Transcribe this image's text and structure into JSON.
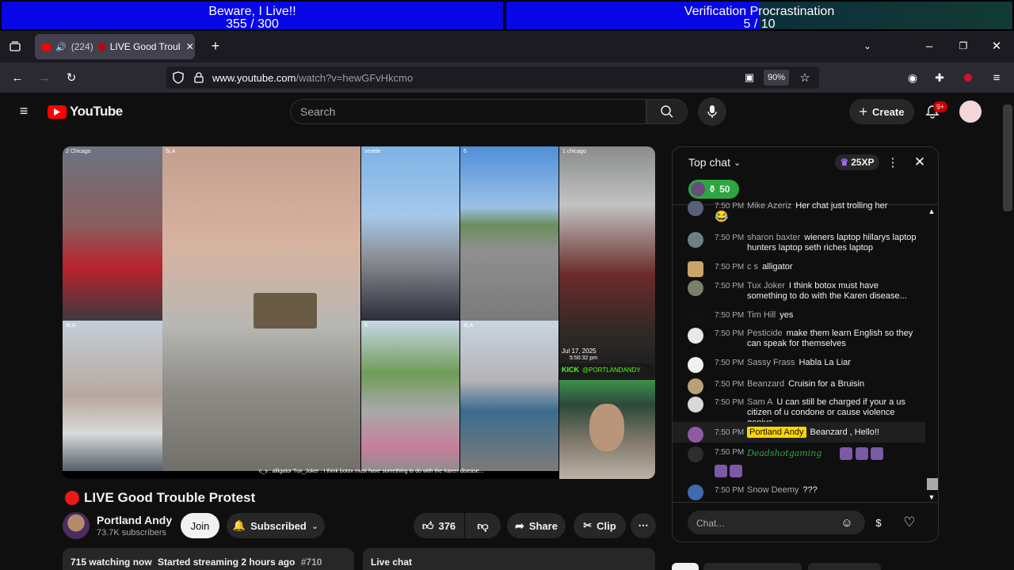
{
  "overlay": {
    "goal1_title": "Beware, I Live!!",
    "goal1_value": "355 / 300",
    "goal2_title": "Verification Procrastination",
    "goal2_value": "5 / 10",
    "goal2_progress": 0.5
  },
  "browser": {
    "tab_count_label": "(224)",
    "tab_title": "LIVE Good Troubl",
    "url_domain": "www.youtube.com",
    "url_path": "/watch?v=hewGFvHkcmo",
    "zoom": "90%"
  },
  "youtube": {
    "logo_text": "YouTube",
    "search_placeholder": "Search",
    "create_label": "Create",
    "notifications_badge": "9+"
  },
  "video": {
    "cells": [
      {
        "label": "2 Chicago"
      },
      {
        "label": "5LA"
      },
      {
        "label": "seattle"
      },
      {
        "label": "6"
      },
      {
        "label": "1 chicago"
      },
      {
        "label": "3LA"
      },
      {
        "label": "5"
      },
      {
        "label": "4LA"
      }
    ],
    "overlay_date": "Jul 17, 2025",
    "overlay_time": "5:50:32 pm",
    "overlay_handle": "@PORTLANDANDY",
    "overlay_kick": "KICK",
    "ticker": "c_s : alligator   Tux_Joker : I think botox must have something to do with the Karen disease..."
  },
  "stream": {
    "title": "LIVE Good Trouble Protest",
    "channel": "Portland Andy",
    "subscribers": "73.7K subscribers",
    "join_label": "Join",
    "subscribed_label": "Subscribed",
    "likes": "376",
    "share_label": "Share",
    "clip_label": "Clip",
    "watching": "715 watching now",
    "started": "Started streaming 2 hours ago",
    "hashtag": "#710",
    "live_chat_label": "Live chat"
  },
  "chat": {
    "header": "Top chat",
    "xp": "25XP",
    "points": "50",
    "input_placeholder": "Chat...",
    "messages": [
      {
        "time": "7:50 PM",
        "author": "Mike Azeriz",
        "text": "Her chat just trolling her",
        "emoji": "😂"
      },
      {
        "time": "7:50 PM",
        "author": "sharon baxter",
        "text": "wieners laptop hillarys laptop hunters laptop seth riches laptop"
      },
      {
        "time": "7:50 PM",
        "author": "c s",
        "text": "alligator"
      },
      {
        "time": "7:50 PM",
        "author": "Tux Joker",
        "text": "I think botox must have something to do with the Karen disease..."
      },
      {
        "time": "7:50 PM",
        "author": "Tim Hill",
        "text": "yes"
      },
      {
        "time": "7:50 PM",
        "author": "Pesticide",
        "text": "make them learn English so they can speak for themselves"
      },
      {
        "time": "7:50 PM",
        "author": "Sassy Frass",
        "text": "Habla La Liar"
      },
      {
        "time": "7:50 PM",
        "author": "Beanzard",
        "text": "Cruisin for a Bruisin"
      },
      {
        "time": "7:50 PM",
        "author": "Sam A",
        "text": "U can still be charged if your a us citizen of u condone or cause violence genius"
      },
      {
        "time": "7:50 PM",
        "author": "Portland Andy",
        "text": "Beanzard , Hello!!"
      },
      {
        "time": "7:50 PM",
        "author": "Deadshotgaming",
        "text": ""
      },
      {
        "time": "7:50 PM",
        "author": "Snow Deemy",
        "text": "???"
      }
    ]
  },
  "colors": {
    "goal_blue": "#0707e8",
    "yt_red": "#ff0000",
    "owner_badge": "#ffd600",
    "points_green": "#2ba640"
  }
}
